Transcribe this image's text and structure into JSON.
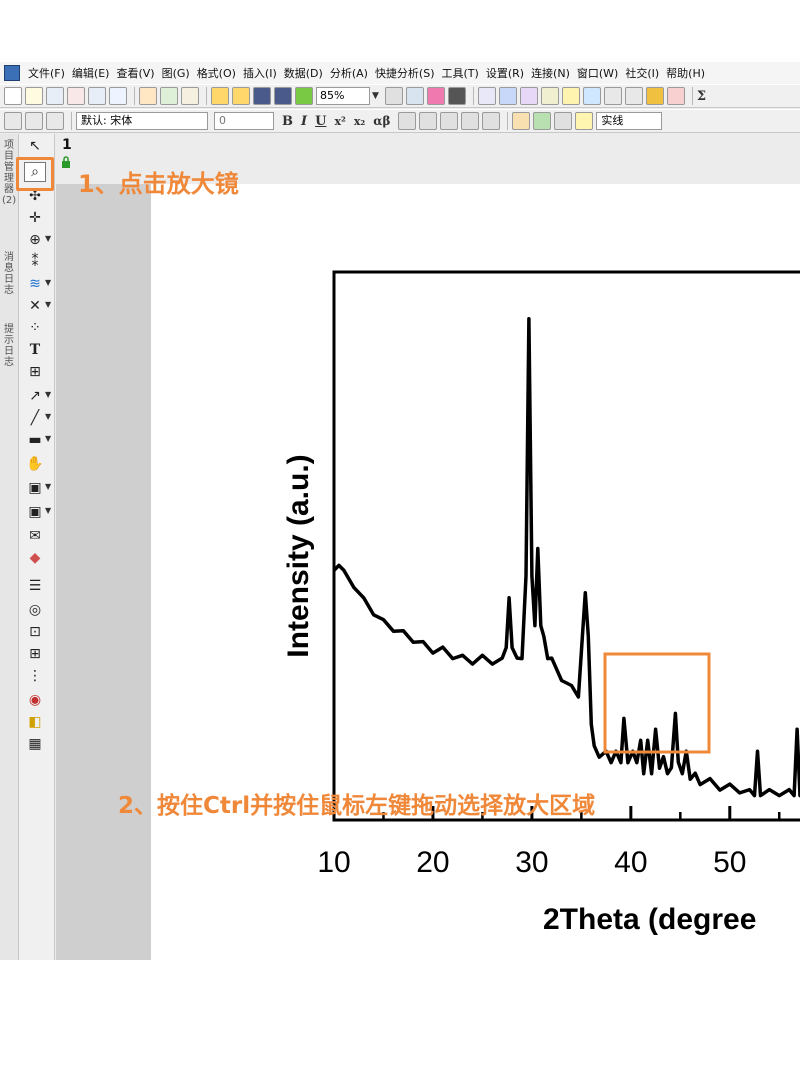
{
  "menubar": {
    "items": [
      "文件(F)",
      "编辑(E)",
      "查看(V)",
      "图(G)",
      "格式(O)",
      "插入(I)",
      "数据(D)",
      "分析(A)",
      "快捷分析(S)",
      "工具(T)",
      "设置(R)",
      "连接(N)",
      "窗口(W)",
      "社交(I)",
      "帮助(H)"
    ]
  },
  "toolbar": {
    "zoom": "85%",
    "font": "默认: 宋体",
    "font_size": "0",
    "bold": "B",
    "italic": "I",
    "underline": "U",
    "superscript": "x²",
    "subscript": "x₂",
    "alpha_beta": "αβ",
    "line_style": "实线",
    "sum": "Σ"
  },
  "left_panel": {
    "tabs": [
      "项目管理器 (2)",
      "消息日志",
      "提示日志"
    ]
  },
  "graph_window": {
    "page_number": "1"
  },
  "annotations": {
    "step1": "1、点击放大镜",
    "step2": "2、按住Ctrl并按住鼠标左键拖动选择放大区域"
  },
  "colors": {
    "annotation": "#f0883a",
    "trace": "#000000"
  },
  "chart_data": {
    "type": "line",
    "xlabel": "2Theta (degree",
    "ylabel": "Intensity (a.u.)",
    "title": "",
    "xlim": [
      10,
      57.5
    ],
    "ylim": [
      0,
      100
    ],
    "x_ticks": [
      10,
      20,
      30,
      40,
      50
    ],
    "x_tick_labels": [
      "10",
      "20",
      "30",
      "40",
      "50"
    ],
    "grid": false,
    "legend": "none",
    "x": [
      10,
      10.5,
      11,
      12,
      13,
      14,
      15,
      16,
      17,
      18,
      19,
      20,
      21,
      22,
      23,
      24,
      25,
      26,
      27,
      27.4,
      27.7,
      28,
      28.5,
      29,
      29.4,
      29.7,
      30,
      30.3,
      30.6,
      30.9,
      31.2,
      31.6,
      32,
      33,
      34,
      34.7,
      35.1,
      35.4,
      35.7,
      36,
      36.3,
      36.8,
      37.5,
      38,
      38.5,
      39,
      39.3,
      39.7,
      40.2,
      40.6,
      41,
      41.3,
      41.7,
      42.1,
      42.5,
      42.9,
      43.3,
      43.7,
      44.1,
      44.5,
      44.8,
      45.2,
      45.6,
      46,
      46.5,
      47,
      48,
      49,
      50,
      51,
      52,
      52.5,
      52.8,
      53.1,
      54,
      55,
      56,
      56.5,
      56.8,
      57.1,
      57.5
    ],
    "y": [
      45,
      47,
      45,
      43,
      40,
      38,
      36,
      35,
      34,
      33,
      32,
      31,
      31,
      30,
      29.5,
      29,
      29.5,
      29,
      29,
      32,
      40,
      32,
      29,
      30,
      44,
      92,
      44,
      36,
      49,
      36,
      33,
      30,
      29,
      26,
      24,
      23,
      33,
      42,
      33,
      18,
      13,
      12,
      12,
      11,
      12,
      11,
      18,
      11,
      12,
      11,
      14,
      9,
      14,
      9,
      16,
      10,
      11,
      9,
      9,
      20,
      10,
      9,
      12,
      8,
      8,
      7,
      7,
      6,
      6,
      5.5,
      5,
      5,
      12,
      5,
      5,
      5,
      5,
      5,
      16,
      5,
      5
    ]
  }
}
